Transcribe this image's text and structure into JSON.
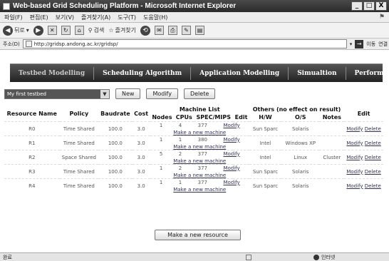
{
  "window": {
    "title": "Web-based Grid Scheduling Platform - Microsoft Internet Explorer",
    "buttons": [
      "_",
      "□",
      "X"
    ]
  },
  "menu": {
    "items": [
      "파일(F)",
      "편집(E)",
      "보기(V)",
      "즐겨찾기(A)",
      "도구(T)",
      "도움말(H)"
    ]
  },
  "toolbar": {
    "back_label": "뒤로",
    "search_label": "검색",
    "favorites_label": "즐겨찾기"
  },
  "address": {
    "label": "주소(D)",
    "url": "http://gridsp.andong.ac.kr/gridsp/",
    "go_label": "이동",
    "links_label": "연결"
  },
  "nav": {
    "items": [
      "Testbed Modelling",
      "Scheduling Algorithm",
      "Application Modelling",
      "Simualtion",
      "Performance"
    ]
  },
  "controls": {
    "testbed_selected": "My first testbed",
    "new_label": "New",
    "modify_label": "Modify",
    "delete_label": "Delete"
  },
  "table": {
    "headers": {
      "resource_name": "Resource Name",
      "policy": "Policy",
      "baudrate": "Baudrate",
      "cost": "Cost",
      "machine_list": "Machine List",
      "nodes": "Nodes",
      "cpus": "CPUs",
      "spec": "SPEC/MIPS",
      "edit": "Edit",
      "others": "Others (no effect on result)",
      "hw": "H/W",
      "os": "O/S",
      "notes": "Notes",
      "edit2": "Edit"
    },
    "make_machine_label": "Make a new machine",
    "modify_link": "Modify",
    "delete_link": "Delete",
    "rows": [
      {
        "name": "R0",
        "policy": "Time Shared",
        "baud": "100.0",
        "cost": "3.0",
        "nodes": "1",
        "cpus": "4",
        "spec": "377",
        "hw": "Sun Sparc",
        "os": "Solaris",
        "notes": ""
      },
      {
        "name": "R1",
        "policy": "Time Shared",
        "baud": "100.0",
        "cost": "3.0",
        "nodes": "1",
        "cpus": "1",
        "spec": "380",
        "hw": "Intel",
        "os": "Windows XP",
        "notes": ""
      },
      {
        "name": "R2",
        "policy": "Space Shared",
        "baud": "100.0",
        "cost": "3.0",
        "nodes": "5",
        "cpus": "2",
        "spec": "377",
        "hw": "Intel",
        "os": "Linux",
        "notes": "Cluster"
      },
      {
        "name": "R3",
        "policy": "Time Shared",
        "baud": "100.0",
        "cost": "3.0",
        "nodes": "1",
        "cpus": "2",
        "spec": "377",
        "hw": "Sun Sparc",
        "os": "Solaris",
        "notes": ""
      },
      {
        "name": "R4",
        "policy": "Time Shared",
        "baud": "100.0",
        "cost": "3.0",
        "nodes": "1",
        "cpus": "1",
        "spec": "377",
        "hw": "Sun Sparc",
        "os": "Solaris",
        "notes": ""
      }
    ]
  },
  "make_resource_label": "Make a new resource",
  "status": {
    "left": "완료",
    "zone": "인터넷"
  }
}
